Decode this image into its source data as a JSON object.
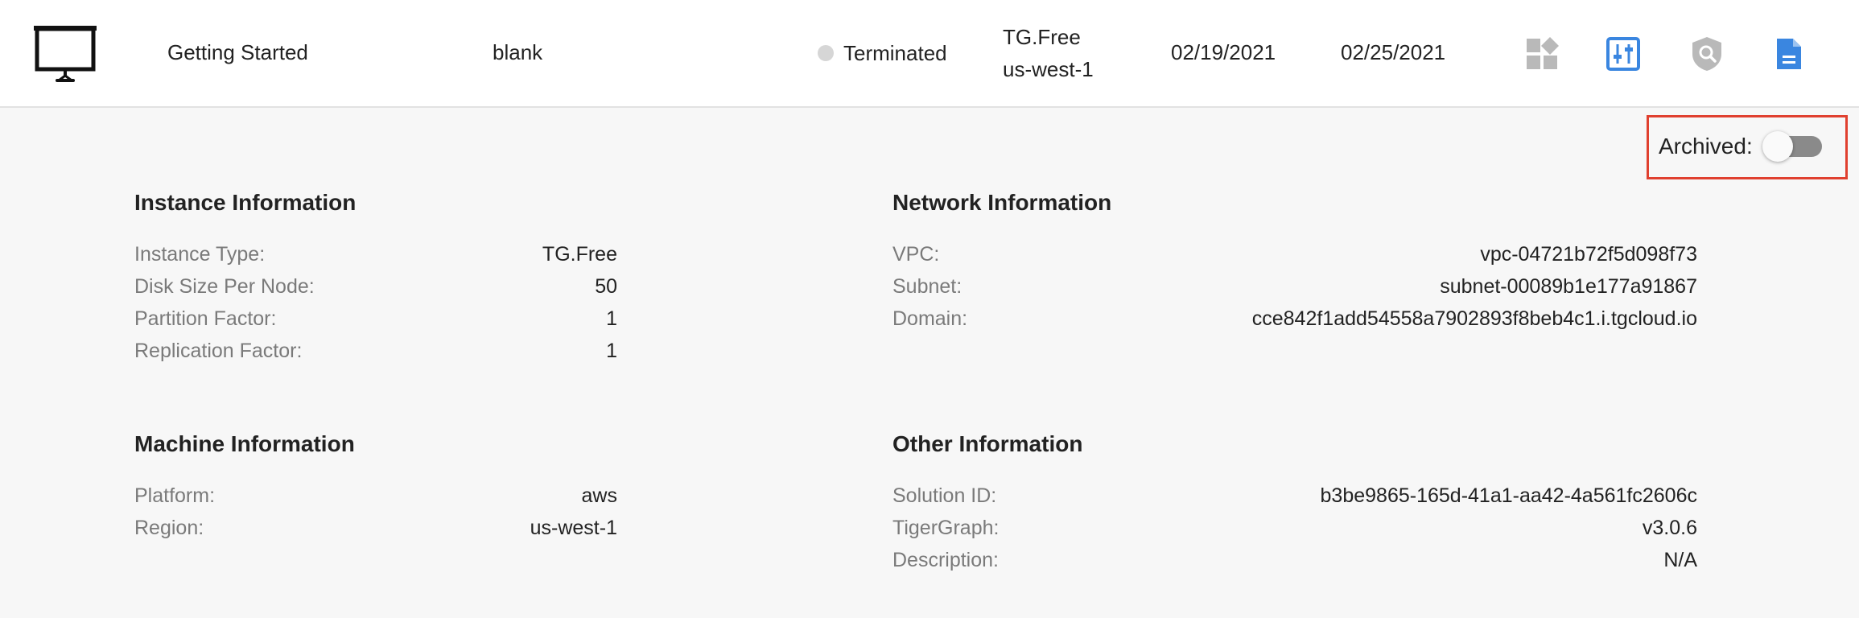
{
  "header": {
    "solution_name": "Getting Started",
    "template": "blank",
    "status": "Terminated",
    "tier": "TG.Free",
    "region": "us-west-1",
    "created_date": "02/19/2021",
    "updated_date": "02/25/2021",
    "status_color": "#d6d6d6",
    "icons": [
      "dashboard-icon",
      "sliders-icon",
      "shield-search-icon",
      "document-icon"
    ]
  },
  "archived": {
    "label": "Archived:",
    "value": false
  },
  "instance": {
    "title": "Instance Information",
    "rows": [
      {
        "label": "Instance Type:",
        "value": "TG.Free"
      },
      {
        "label": "Disk Size Per Node:",
        "value": "50"
      },
      {
        "label": "Partition Factor:",
        "value": "1"
      },
      {
        "label": "Replication Factor:",
        "value": "1"
      }
    ]
  },
  "network": {
    "title": "Network Information",
    "rows": [
      {
        "label": "VPC:",
        "value": "vpc-04721b72f5d098f73"
      },
      {
        "label": "Subnet:",
        "value": "subnet-00089b1e177a91867"
      },
      {
        "label": "Domain:",
        "value": "cce842f1add54558a7902893f8beb4c1.i.tgcloud.io"
      }
    ]
  },
  "machine": {
    "title": "Machine Information",
    "rows": [
      {
        "label": "Platform:",
        "value": "aws"
      },
      {
        "label": "Region:",
        "value": "us-west-1"
      }
    ]
  },
  "other": {
    "title": "Other Information",
    "rows": [
      {
        "label": "Solution ID:",
        "value": "b3be9865-165d-41a1-aa42-4a561fc2606c"
      },
      {
        "label": "TigerGraph:",
        "value": "v3.0.6"
      },
      {
        "label": "Description:",
        "value": "N/A"
      }
    ]
  }
}
